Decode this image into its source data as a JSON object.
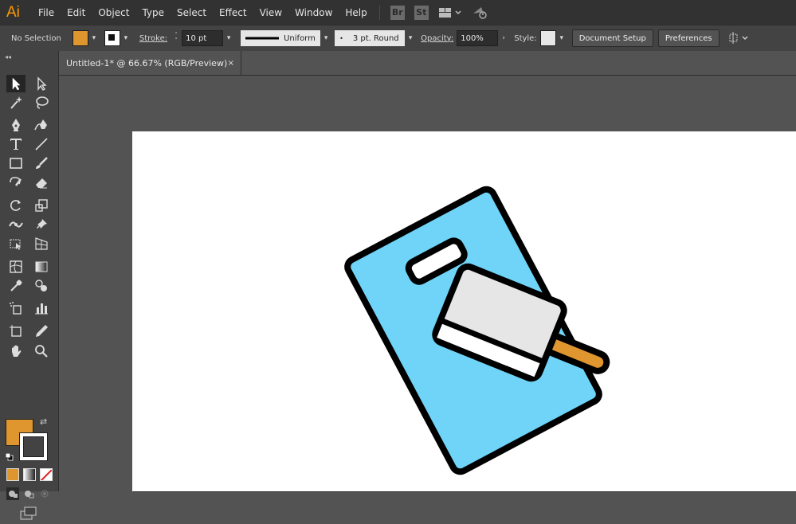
{
  "app": {
    "logo": "Ai"
  },
  "menu": [
    "File",
    "Edit",
    "Object",
    "Type",
    "Select",
    "Effect",
    "View",
    "Window",
    "Help"
  ],
  "appbuttons": {
    "bridge": "Br",
    "stock": "St"
  },
  "control": {
    "selection": "No Selection",
    "fill_color": "#e0962f",
    "stroke_label": "Stroke:",
    "stroke_weight": "10 pt",
    "stroke_profile": "Uniform",
    "brush": "3 pt. Round",
    "opacity_label": "Opacity:",
    "opacity": "100%",
    "style_label": "Style:",
    "document_setup": "Document Setup",
    "preferences": "Preferences"
  },
  "document": {
    "tab_title": "Untitled-1* @ 66.67% (RGB/Preview)",
    "close": "×"
  },
  "toolbar": {
    "fill_color": "#e0962f",
    "stroke_color": "#000000"
  },
  "artwork": {
    "board_color": "#6fd4f7",
    "blade_color": "#e6e6e6",
    "handle_color": "#e0962f",
    "outline": "#000000"
  }
}
